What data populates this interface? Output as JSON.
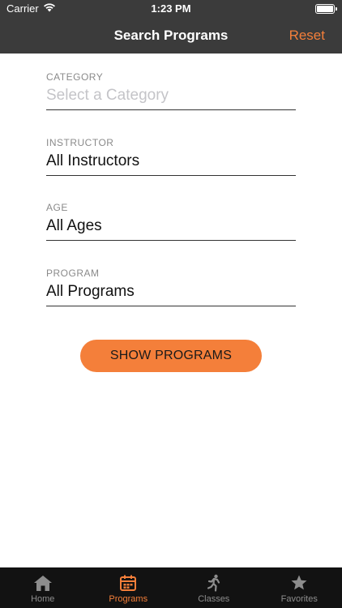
{
  "status_bar": {
    "carrier": "Carrier",
    "time": "1:23 PM",
    "icons": [
      "wifi-icon",
      "battery-icon"
    ]
  },
  "nav": {
    "title": "Search Programs",
    "reset_label": "Reset"
  },
  "form": {
    "category": {
      "label": "CATEGORY",
      "placeholder": "Select a Category",
      "value": ""
    },
    "instructor": {
      "label": "INSTRUCTOR",
      "value": "All Instructors"
    },
    "age": {
      "label": "AGE",
      "value": "All Ages"
    },
    "program": {
      "label": "PROGRAM",
      "value": "All Programs"
    }
  },
  "show_button_label": "SHOW PROGRAMS",
  "tabs": [
    {
      "label": "Home",
      "icon": "home-icon"
    },
    {
      "label": "Programs",
      "icon": "calendar-icon",
      "active": true
    },
    {
      "label": "Classes",
      "icon": "runner-icon"
    },
    {
      "label": "Favorites",
      "icon": "star-icon"
    }
  ],
  "colors": {
    "accent": "#f47f3a",
    "nav_background": "#3b3b3b",
    "tab_background": "#121212",
    "tab_inactive": "#8d8d8d"
  }
}
